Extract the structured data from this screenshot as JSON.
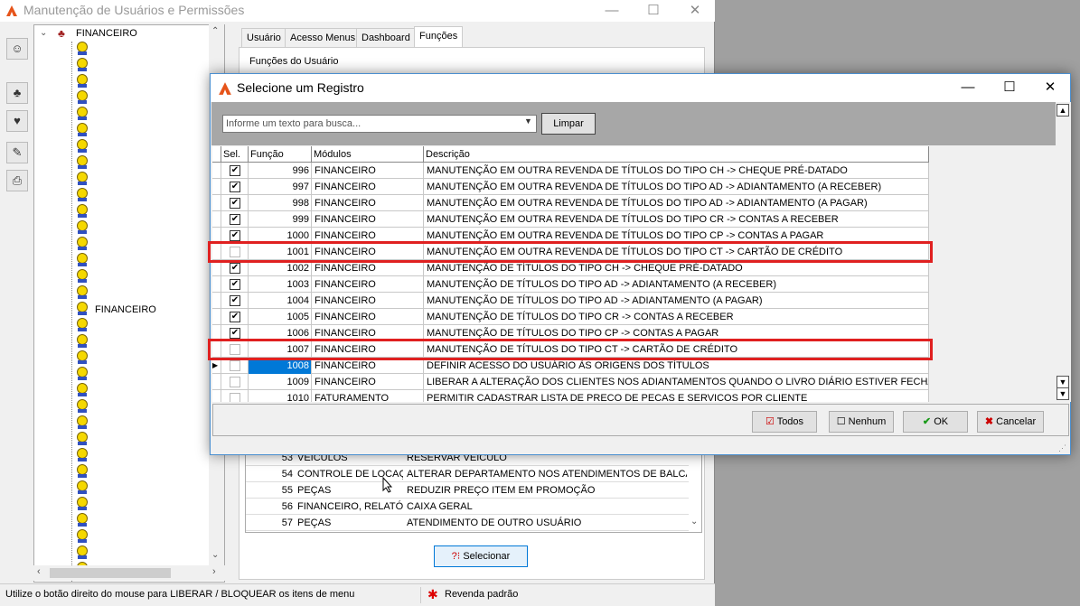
{
  "main_window": {
    "title": "Manutenção de Usuários e Permissões",
    "minimize_glyph": "—",
    "maximize_glyph": "☐",
    "close_glyph": "✕"
  },
  "toolbar": {
    "icons": [
      "user-key-icon",
      "users-icon",
      "user-lock-icon",
      "edit-list-icon",
      "printer-icon"
    ]
  },
  "tree": {
    "root_label": "FINANCEIRO",
    "group_label": "FINANCEIRO"
  },
  "tabs": [
    "Usuário",
    "Acesso Menus",
    "Dashboard",
    "Funções"
  ],
  "active_tab": "Funções",
  "functions_panel": {
    "label": "Funções do Usuário"
  },
  "background_rows": [
    {
      "id": "53",
      "module": "VEÍCULOS",
      "desc": "RESERVAR VEÍCULO"
    },
    {
      "id": "54",
      "module": "CONTROLE DE LOCAÇÃO",
      "desc": "ALTERAR DEPARTAMENTO NOS ATENDIMENTOS DE BALCÃO/OF"
    },
    {
      "id": "55",
      "module": "PEÇAS",
      "desc": "REDUZIR PREÇO ITEM EM PROMOÇÃO"
    },
    {
      "id": "56",
      "module": "FINANCEIRO, RELATÓR",
      "desc": "CAIXA GERAL"
    },
    {
      "id": "57",
      "module": "PEÇAS",
      "desc": "ATENDIMENTO DE OUTRO USUÁRIO"
    }
  ],
  "select_button": {
    "label": "Selecionar"
  },
  "status_bar": {
    "hint": "Utilize o botão direito do mouse para LIBERAR / BLOQUEAR os itens de menu",
    "default_dealer": "Revenda padrão"
  },
  "dialog": {
    "title": "Selecione um Registro",
    "search_placeholder": "Informe um texto para busca...",
    "clear_label": "Limpar",
    "columns": [
      "Sel.",
      "Função",
      "Módulos",
      "Descrição"
    ],
    "rows": [
      {
        "checked": true,
        "id": "996",
        "module": "FINANCEIRO",
        "desc": "MANUTENÇÃO EM OUTRA REVENDA DE TÍTULOS DO TIPO CH -> CHEQUE PRÉ-DATADO"
      },
      {
        "checked": true,
        "id": "997",
        "module": "FINANCEIRO",
        "desc": "MANUTENÇÃO EM OUTRA REVENDA DE TÍTULOS DO TIPO AD -> ADIANTAMENTO (A RECEBER)"
      },
      {
        "checked": true,
        "id": "998",
        "module": "FINANCEIRO",
        "desc": "MANUTENÇÃO EM OUTRA REVENDA DE TÍTULOS DO TIPO AD -> ADIANTAMENTO (A PAGAR)"
      },
      {
        "checked": true,
        "id": "999",
        "module": "FINANCEIRO",
        "desc": "MANUTENÇÃO EM OUTRA REVENDA DE TÍTULOS DO TIPO CR -> CONTAS A RECEBER"
      },
      {
        "checked": true,
        "id": "1000",
        "module": "FINANCEIRO",
        "desc": "MANUTENÇÃO EM OUTRA REVENDA DE TÍTULOS DO TIPO CP -> CONTAS A PAGAR"
      },
      {
        "checked": false,
        "id": "1001",
        "module": "FINANCEIRO",
        "desc": "MANUTENÇÃO EM OUTRA REVENDA DE TÍTULOS DO TIPO CT -> CARTÃO DE CRÉDITO",
        "highlighted": true
      },
      {
        "checked": true,
        "id": "1002",
        "module": "FINANCEIRO",
        "desc": "MANUTENÇÃO DE TÍTULOS DO TIPO CH -> CHEQUE PRÉ-DATADO"
      },
      {
        "checked": true,
        "id": "1003",
        "module": "FINANCEIRO",
        "desc": "MANUTENÇÃO DE TÍTULOS DO TIPO AD -> ADIANTAMENTO (A RECEBER)"
      },
      {
        "checked": true,
        "id": "1004",
        "module": "FINANCEIRO",
        "desc": "MANUTENÇÃO DE TÍTULOS DO TIPO AD -> ADIANTAMENTO (A PAGAR)"
      },
      {
        "checked": true,
        "id": "1005",
        "module": "FINANCEIRO",
        "desc": "MANUTENÇÃO DE TÍTULOS DO TIPO CR -> CONTAS A RECEBER"
      },
      {
        "checked": true,
        "id": "1006",
        "module": "FINANCEIRO",
        "desc": "MANUTENÇÃO DE TÍTULOS DO TIPO CP -> CONTAS A PAGAR"
      },
      {
        "checked": false,
        "id": "1007",
        "module": "FINANCEIRO",
        "desc": "MANUTENÇÃO DE TÍTULOS DO TIPO CT -> CARTÃO DE CRÉDITO",
        "highlighted": true
      },
      {
        "checked": false,
        "id": "1008",
        "module": "FINANCEIRO",
        "desc": "DEFINIR ACESSO DO USUÁRIO ÀS ORIGENS DOS TÍTULOS",
        "current": true
      },
      {
        "checked": false,
        "id": "1009",
        "module": "FINANCEIRO",
        "desc": "LIBERAR A ALTERAÇÃO DOS CLIENTES NOS ADIANTAMENTOS QUANDO O LIVRO DIÁRIO ESTIVER FECHADO"
      },
      {
        "checked": false,
        "id": "1010",
        "module": "FATURAMENTO",
        "desc": "PERMITIR CADASTRAR LISTA DE PRECO DE PECAS E SERVICOS POR CLIENTE"
      }
    ],
    "buttons": {
      "all": "Todos",
      "none": "Nenhum",
      "ok": "OK",
      "cancel": "Cancelar"
    },
    "colors": {
      "highlight": "#e02020",
      "current_cell": "#0078d7"
    }
  }
}
